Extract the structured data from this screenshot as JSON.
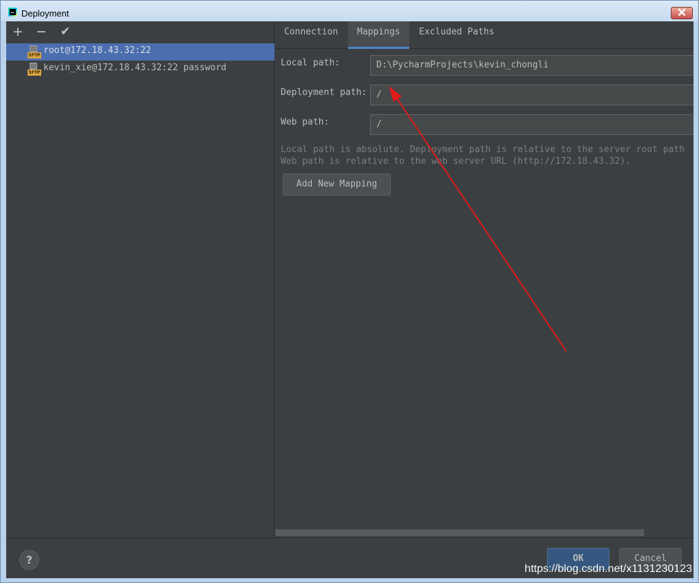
{
  "window": {
    "title": "Deployment",
    "close_glyph": "✕"
  },
  "toolbar": {
    "add_glyph": "+",
    "remove_glyph": "−",
    "apply_glyph": "✔"
  },
  "servers": [
    {
      "name": "root@172.18.43.32:22",
      "selected": true,
      "icon": "sftp-server-icon",
      "badge": "SFTP"
    },
    {
      "name": "kevin_xie@172.18.43.32:22 password",
      "selected": false,
      "icon": "sftp-server-icon",
      "badge": "SFTP"
    }
  ],
  "tabs": [
    {
      "label": "Connection",
      "active": false
    },
    {
      "label": "Mappings",
      "active": true
    },
    {
      "label": "Excluded Paths",
      "active": false
    }
  ],
  "mappings": {
    "local_path_label": "Local path:",
    "local_path_value": "D:\\PycharmProjects\\kevin_chongli",
    "deployment_path_label": "Deployment path:",
    "deployment_path_value": "/",
    "web_path_label": "Web path:",
    "web_path_value": "/",
    "hint_line1": "Local path is absolute. Deployment path is relative to the server root path",
    "hint_line2": "Web path is relative to the web server URL (http://172.18.43.32).",
    "add_mapping_label": "Add New Mapping"
  },
  "footer": {
    "help_glyph": "?",
    "ok_label": "OK",
    "cancel_label": "Cancel"
  },
  "watermark": "https://blog.csdn.net/x1131230123",
  "colors": {
    "background": "#3c3f41",
    "selection": "#4b6eaf",
    "accent": "#4a88c7",
    "annotation_arrow": "#e01b1b"
  }
}
